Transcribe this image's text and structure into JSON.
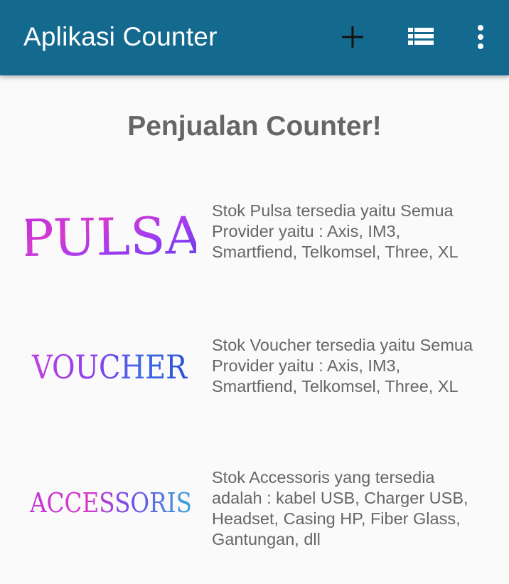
{
  "appbar": {
    "title": "Aplikasi Counter",
    "background": "#136a8e",
    "actions": [
      {
        "name": "add",
        "icon": "plus-icon"
      },
      {
        "name": "list",
        "icon": "list-icon"
      },
      {
        "name": "overflow",
        "icon": "more-vert-icon"
      }
    ]
  },
  "main": {
    "title": "Penjualan Counter!",
    "items": [
      {
        "logo_text": "PULSA",
        "logo_icon": "pulsa-logo",
        "description": "Stok Pulsa tersedia yaitu Semua Provider yaitu : Axis, IM3, Smartfiend, Telkomsel, Three, XL"
      },
      {
        "logo_text": "VOUCHER",
        "logo_icon": "voucher-logo",
        "description": "Stok Voucher tersedia yaitu Semua Provider yaitu : Axis, IM3, Smartfiend, Telkomsel, Three, XL"
      },
      {
        "logo_text": "ACCESSORIS",
        "logo_icon": "accessoris-logo",
        "description": "Stok Accessoris yang tersedia adalah : kabel USB, Charger USB, Headset, Casing HP, Fiber Glass, Gantungan, dll"
      }
    ]
  }
}
